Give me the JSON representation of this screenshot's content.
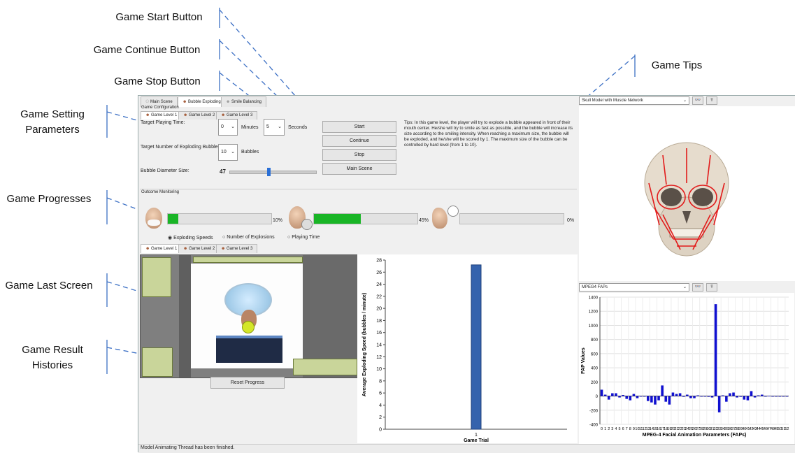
{
  "callouts": {
    "start": "Game Start Button",
    "continue": "Game Continue Button",
    "stop": "Game Stop Button",
    "tips": "Game Tips",
    "settings_line1": "Game Setting",
    "settings_line2": "Parameters",
    "progresses": "Game Progresses",
    "last_screen": "Game Last Screen",
    "histories_line1": "Game Result",
    "histories_line2": "Histories"
  },
  "main_tabs": [
    "Main Scene",
    "Bubble Exploding",
    "Smile Balancing"
  ],
  "config": {
    "group": "Game Configuration",
    "level_tabs": [
      "Game Level 1",
      "Game Level 2",
      "Game Level 3"
    ],
    "playing_time_label": "Target Playing Time:",
    "minutes_value": "0",
    "minutes_label": "Minutes",
    "seconds_value": "5",
    "seconds_label": "Seconds",
    "bubbles_label": "Target Number of Exploding Bubbles:",
    "bubbles_value": "10",
    "bubbles_unit": "Bubbles",
    "diameter_label": "Bubble Diameter Size:",
    "diameter_value": "47",
    "diameter_slider_fraction": 0.45
  },
  "buttons": {
    "start": "Start",
    "continue": "Continue",
    "stop": "Stop",
    "main_scene": "Main Scene",
    "reset": "Reset Progress"
  },
  "tips": "Tips: In this game level, the player will try to explode a bubble appeared in front of their mouth center. He/she will try to smile as fast as possible, and the bubble will increase its size according to the smiling intensity. When reaching a maximum size, the bubble will be exploded, and he/she will be scored by 1. The maximum size of the bubble can be controlled by hard level (from 1 to 10).",
  "outcome": {
    "group": "Outcome Monitoring",
    "progress": [
      {
        "label": "10%",
        "value": 0.1
      },
      {
        "label": "45%",
        "value": 0.45
      },
      {
        "label": "0%",
        "value": 0.0
      }
    ],
    "radios": [
      "Exploding Speeds",
      "Number of Explosions",
      "Playing Time"
    ],
    "selected_radio": "Exploding Speeds",
    "level_tabs": [
      "Game Level 1",
      "Game Level 2",
      "Game Level 3"
    ]
  },
  "right_panel": {
    "model_select": "Skull Model with Muscle Network",
    "faps_select": "MPEG4 FAPs"
  },
  "status": "Model Animating Thread has been finished.",
  "colors": {
    "progress": "#19b526",
    "speed_bar": "#3563ad",
    "fap_bar": "#1010d0"
  },
  "chart_data": [
    {
      "type": "bar",
      "categories": [
        "1"
      ],
      "values": [
        27.2
      ],
      "xlabel": "Game Trial",
      "ylabel": "Average Exploding Speed (bubbles / minute)",
      "ylim": [
        0,
        28
      ],
      "yticks": [
        0,
        2,
        4,
        6,
        8,
        10,
        12,
        14,
        16,
        18,
        20,
        22,
        24,
        26,
        28
      ],
      "grid": false
    },
    {
      "type": "bar",
      "x": [
        0,
        1,
        2,
        3,
        4,
        5,
        6,
        7,
        8,
        9,
        10,
        11,
        12,
        13,
        14,
        15,
        16,
        17,
        18,
        19,
        20,
        21,
        22,
        23,
        24,
        25,
        26,
        27,
        28,
        29,
        30,
        31,
        32,
        33,
        34,
        35,
        36,
        37,
        38,
        39,
        40,
        41,
        42,
        43,
        44,
        45,
        46,
        47,
        48,
        49,
        50,
        51,
        52
      ],
      "values": [
        90,
        20,
        -50,
        40,
        40,
        -20,
        15,
        -40,
        -60,
        30,
        -30,
        0,
        0,
        -70,
        -90,
        -120,
        -60,
        150,
        -80,
        -120,
        50,
        30,
        40,
        -10,
        20,
        -30,
        -30,
        10,
        0,
        0,
        -10,
        -20,
        1300,
        -230,
        10,
        -80,
        40,
        50,
        -20,
        -10,
        -50,
        -60,
        70,
        -20,
        10,
        20,
        0,
        5,
        0,
        0,
        0,
        0,
        0
      ],
      "xlabel": "MPEG-4 Facial Animation Parameters (FAPs)",
      "ylabel": "FAP Values",
      "ylim": [
        -400,
        1400
      ],
      "yticks": [
        -400,
        -200,
        0,
        200,
        400,
        600,
        800,
        1000,
        1200,
        1400
      ],
      "grid": true
    }
  ]
}
